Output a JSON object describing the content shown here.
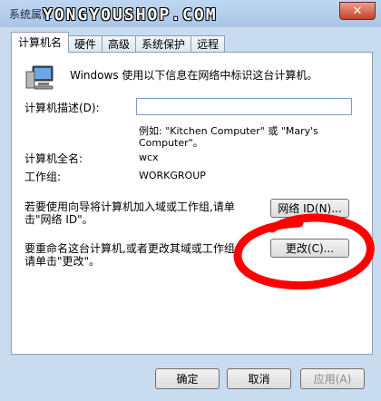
{
  "window": {
    "title": "系统属性",
    "watermark": "YONGYOUSHOP.COM",
    "close_glyph": "✕"
  },
  "tabs": [
    {
      "label": "计算机名",
      "active": true
    },
    {
      "label": "硬件",
      "active": false
    },
    {
      "label": "高级",
      "active": false
    },
    {
      "label": "系统保护",
      "active": false
    },
    {
      "label": "远程",
      "active": false
    }
  ],
  "panel": {
    "intro": "Windows 使用以下信息在网络中标识这台计算机。",
    "desc_label": "计算机描述(D):",
    "desc_value": "",
    "example_line1": "例如: \"Kitchen Computer\" 或 \"Mary's",
    "example_line2": "Computer\"。",
    "fullname_label": "计算机全名:",
    "fullname_value": "wcx",
    "workgroup_label": "工作组:",
    "workgroup_value": "WORKGROUP",
    "join_text1": "若要使用向导将计算机加入域或工作组,请单",
    "join_text2": "击\"网络 ID\"。",
    "network_id_button": "网络 ID(N)...",
    "rename_text1": "要重命名这台计算机,或者更改其域或工作组,",
    "rename_text2": "请单击\"更改\"。",
    "change_button": "更改(C)..."
  },
  "footer": {
    "ok": "确定",
    "cancel": "取消",
    "apply": "应用(A)"
  },
  "colors": {
    "annotation_circle": "#ff0000",
    "window_frame": "#c9dbee"
  }
}
